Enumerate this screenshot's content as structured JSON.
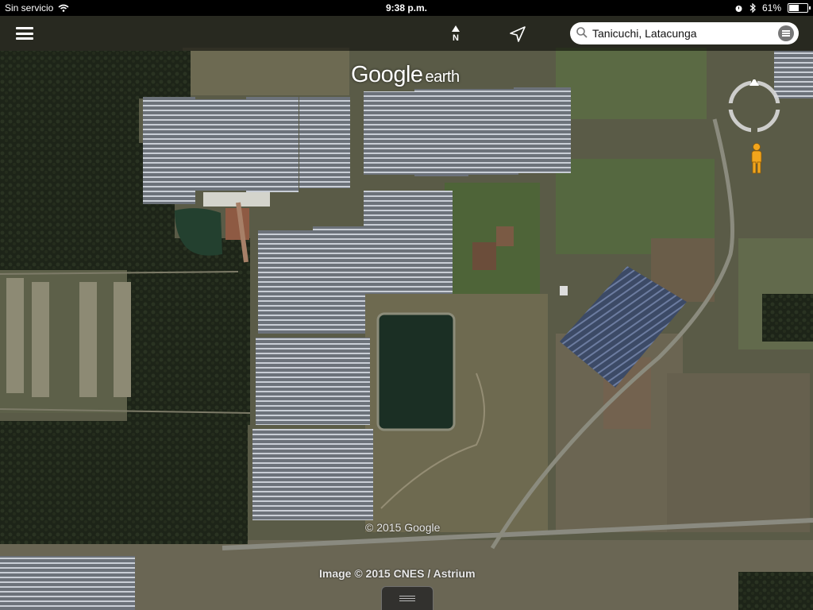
{
  "status_bar": {
    "carrier": "Sin servicio",
    "time": "9:38 p.m.",
    "battery_percent": "61%",
    "battery_level": 0.61,
    "icons": [
      "wifi-icon",
      "alarm-icon",
      "bluetooth-icon",
      "battery-icon"
    ]
  },
  "toolbar": {
    "menu_icon": "menu-icon",
    "north_label": "N",
    "locate_icon": "location-arrow-icon",
    "search": {
      "value": "Tanicuchi, Latacunga",
      "icon": "search-icon",
      "options_icon": "options-icon"
    }
  },
  "branding": {
    "google": "Google",
    "earth": "earth"
  },
  "attribution": {
    "copyright": "© 2015 Google",
    "imagery": "Image © 2015 CNES / Astrium"
  },
  "colors": {
    "accent_pegman": "#f2a51c",
    "search_bg": "#ffffff",
    "toolbar_bg": "rgba(0,0,0,0.55)"
  }
}
